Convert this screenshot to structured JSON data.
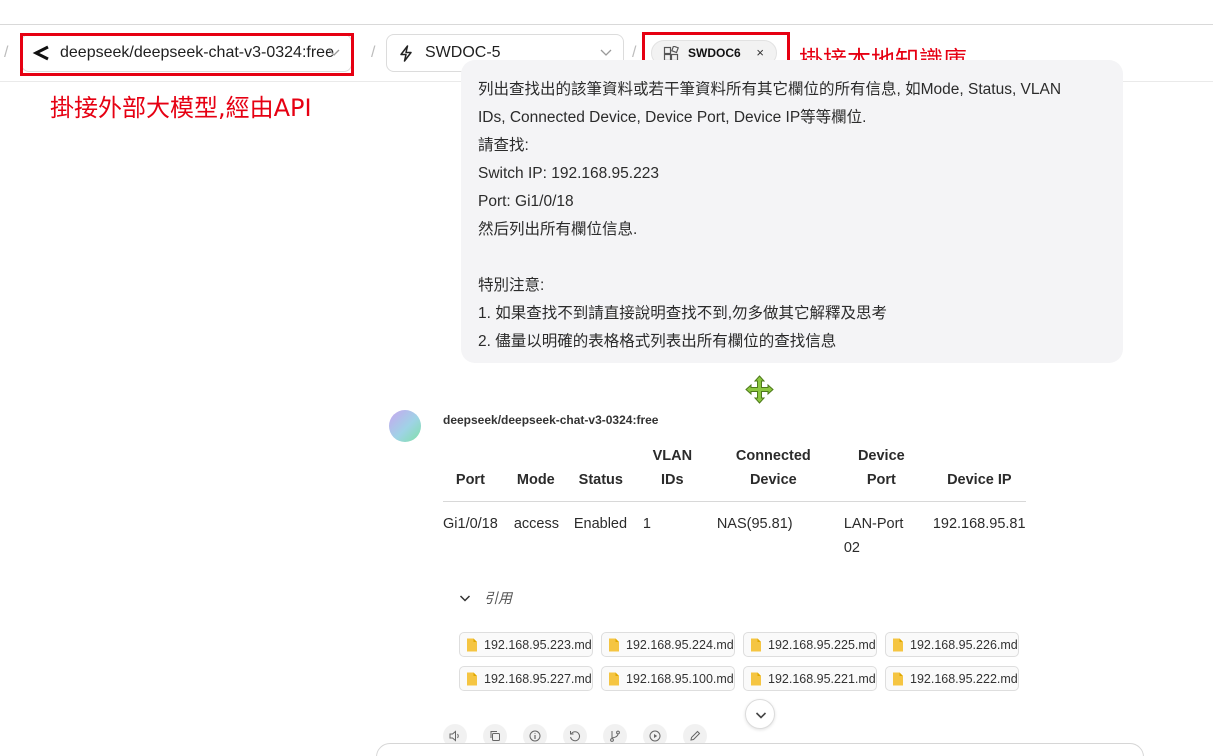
{
  "header": {
    "model_selector": {
      "value": "deepseek/deepseek-chat-v3-0324:free"
    },
    "knowledge_selector": {
      "value": "SWDOC-5"
    },
    "knowledge_tag": {
      "label": "SWDOC6",
      "close": "×"
    },
    "separator": "/"
  },
  "annotations": {
    "model_note": "掛接外部大模型,經由API",
    "kb_note": "掛接本地知識庫",
    "accent": "#e60012"
  },
  "user_message": {
    "lines": [
      "列出查找出的該筆資料或若干筆資料所有其它欄位的所有信息, 如Mode, Status, VLAN",
      "IDs, Connected Device, Device Port, Device IP等等欄位.",
      "請查找:",
      "Switch IP:  192.168.95.223",
      "Port: Gi1/0/18",
      "然后列出所有欄位信息.",
      "",
      "特別注意:",
      "1. 如果查找不到請直接說明查找不到,勿多做其它解釋及思考",
      "2. 儘量以明確的表格格式列表出所有欄位的查找信息"
    ]
  },
  "assistant": {
    "name": "deepseek/deepseek-chat-v3-0324:free",
    "table": {
      "headers": [
        [
          "Port"
        ],
        [
          "Mode"
        ],
        [
          "Status"
        ],
        [
          "VLAN",
          "IDs"
        ],
        [
          "Connected",
          "Device"
        ],
        [
          "Device",
          "Port"
        ],
        [
          "Device IP"
        ]
      ],
      "rows": [
        [
          [
            "Gi1/0/18"
          ],
          [
            "access"
          ],
          [
            "Enabled"
          ],
          [
            "1"
          ],
          [
            "NAS(95.81)"
          ],
          [
            "LAN-Port",
            "02"
          ],
          [
            "192.168.95.81"
          ]
        ]
      ]
    },
    "references_label": "引用",
    "files": [
      "192.168.95.223.md",
      "192.168.95.224.md",
      "192.168.95.225.md",
      "192.168.95.226.md",
      "192.168.95.227.md",
      "192.168.95.100.md",
      "192.168.95.221.md",
      "192.168.95.222.md"
    ],
    "actions": [
      "speaker-icon",
      "copy-icon",
      "info-icon",
      "regenerate-icon",
      "branch-icon",
      "play-icon",
      "edit-icon"
    ]
  }
}
